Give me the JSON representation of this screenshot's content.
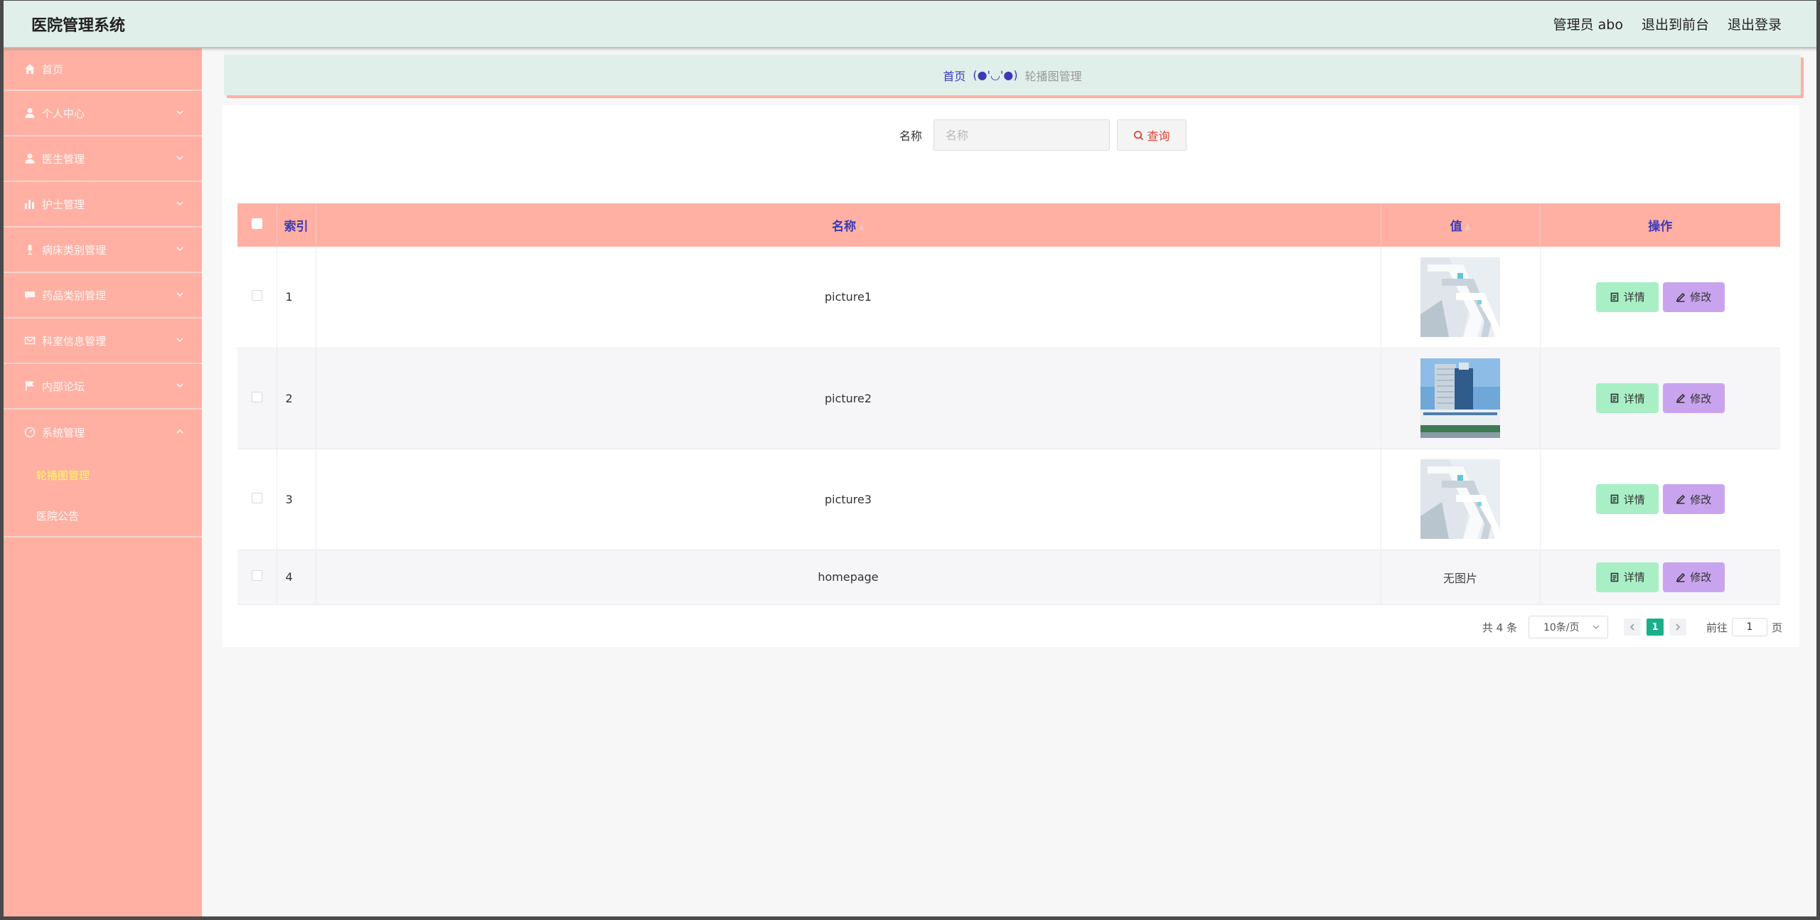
{
  "header": {
    "title": "医院管理系统",
    "user_label": "管理员 abo",
    "to_front": "退出到前台",
    "logout": "退出登录"
  },
  "sidebar": {
    "items": [
      {
        "label": "首页",
        "icon": "home-icon"
      },
      {
        "label": "个人中心",
        "icon": "user-icon"
      },
      {
        "label": "医生管理",
        "icon": "user-icon"
      },
      {
        "label": "护士管理",
        "icon": "bar-chart-icon"
      },
      {
        "label": "病床类别管理",
        "icon": "microphone-icon"
      },
      {
        "label": "药品类别管理",
        "icon": "chat-icon"
      },
      {
        "label": "科室信息管理",
        "icon": "mail-icon"
      },
      {
        "label": "内部论坛",
        "icon": "flag-icon"
      },
      {
        "label": "系统管理",
        "icon": "dashboard-icon"
      }
    ],
    "submenu": [
      {
        "label": "轮播图管理",
        "active": true
      },
      {
        "label": "医院公告",
        "active": false
      }
    ]
  },
  "breadcrumb": {
    "home": "首页",
    "separator": "(●'◡'●)",
    "current": "轮播图管理"
  },
  "search": {
    "label": "名称",
    "placeholder": "名称",
    "button": "查询"
  },
  "table": {
    "headers": {
      "index": "索引",
      "name": "名称",
      "value": "值",
      "ops": "操作"
    },
    "rows": [
      {
        "index": "1",
        "name": "picture1",
        "image": "building-white-1",
        "no_image": ""
      },
      {
        "index": "2",
        "name": "picture2",
        "image": "hospital-tower",
        "no_image": ""
      },
      {
        "index": "3",
        "name": "picture3",
        "image": "building-white-1",
        "no_image": ""
      },
      {
        "index": "4",
        "name": "homepage",
        "image": "",
        "no_image": "无图片"
      }
    ],
    "detail_label": "详情",
    "edit_label": "修改"
  },
  "pagination": {
    "total": "共 4 条",
    "page_size": "10条/页",
    "current_page": "1",
    "goto_prefix": "前往",
    "goto_value": "1",
    "goto_suffix": "页"
  },
  "colors": {
    "sidebar": "#ffb0a3",
    "header": "#e0efe9",
    "detail_btn": "#a8efc6",
    "edit_btn": "#c8a4ee",
    "link": "#3a3ab8",
    "active_submenu": "#fffd54"
  }
}
